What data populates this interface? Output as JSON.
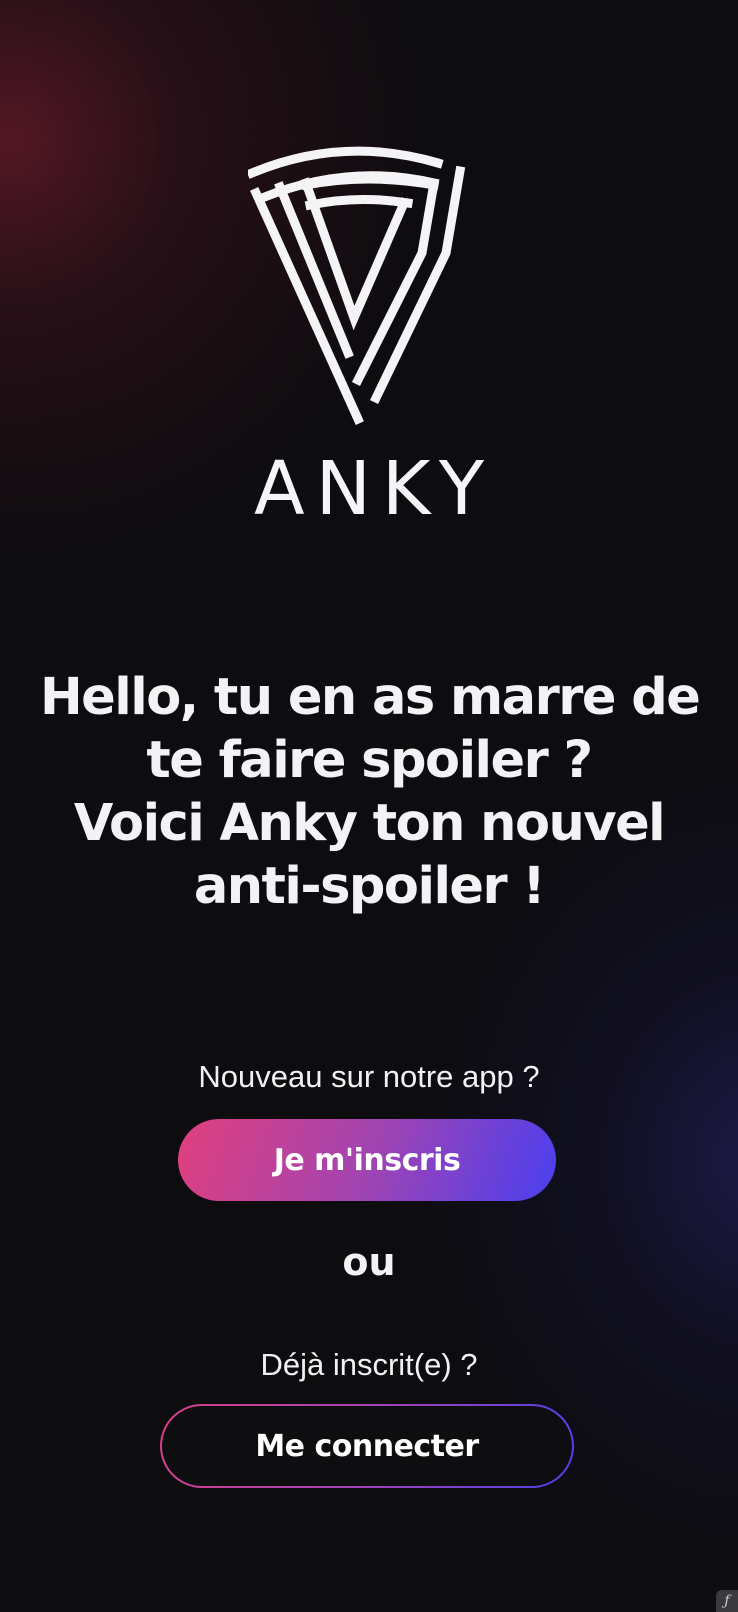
{
  "brand": {
    "name": "ANKY",
    "logo_icon": "anky-shield-logo-icon"
  },
  "headline": {
    "lines": [
      "Hello, tu en as marre de",
      "te faire spoiler ?",
      "Voici Anky ton nouvel",
      "anti-spoiler !"
    ]
  },
  "signup": {
    "prompt": "Nouveau sur notre app ?",
    "button_label": "Je m'inscris"
  },
  "separator": "ou",
  "login": {
    "prompt": "Déjà inscrit(e) ?",
    "button_label": "Me connecter"
  },
  "colors": {
    "background": "#0d0c0f",
    "gradient_start": "#e13f7d",
    "gradient_end": "#4a3ff0",
    "text": "#f3f2f4"
  },
  "corner_badge_icon": "script-f-icon"
}
